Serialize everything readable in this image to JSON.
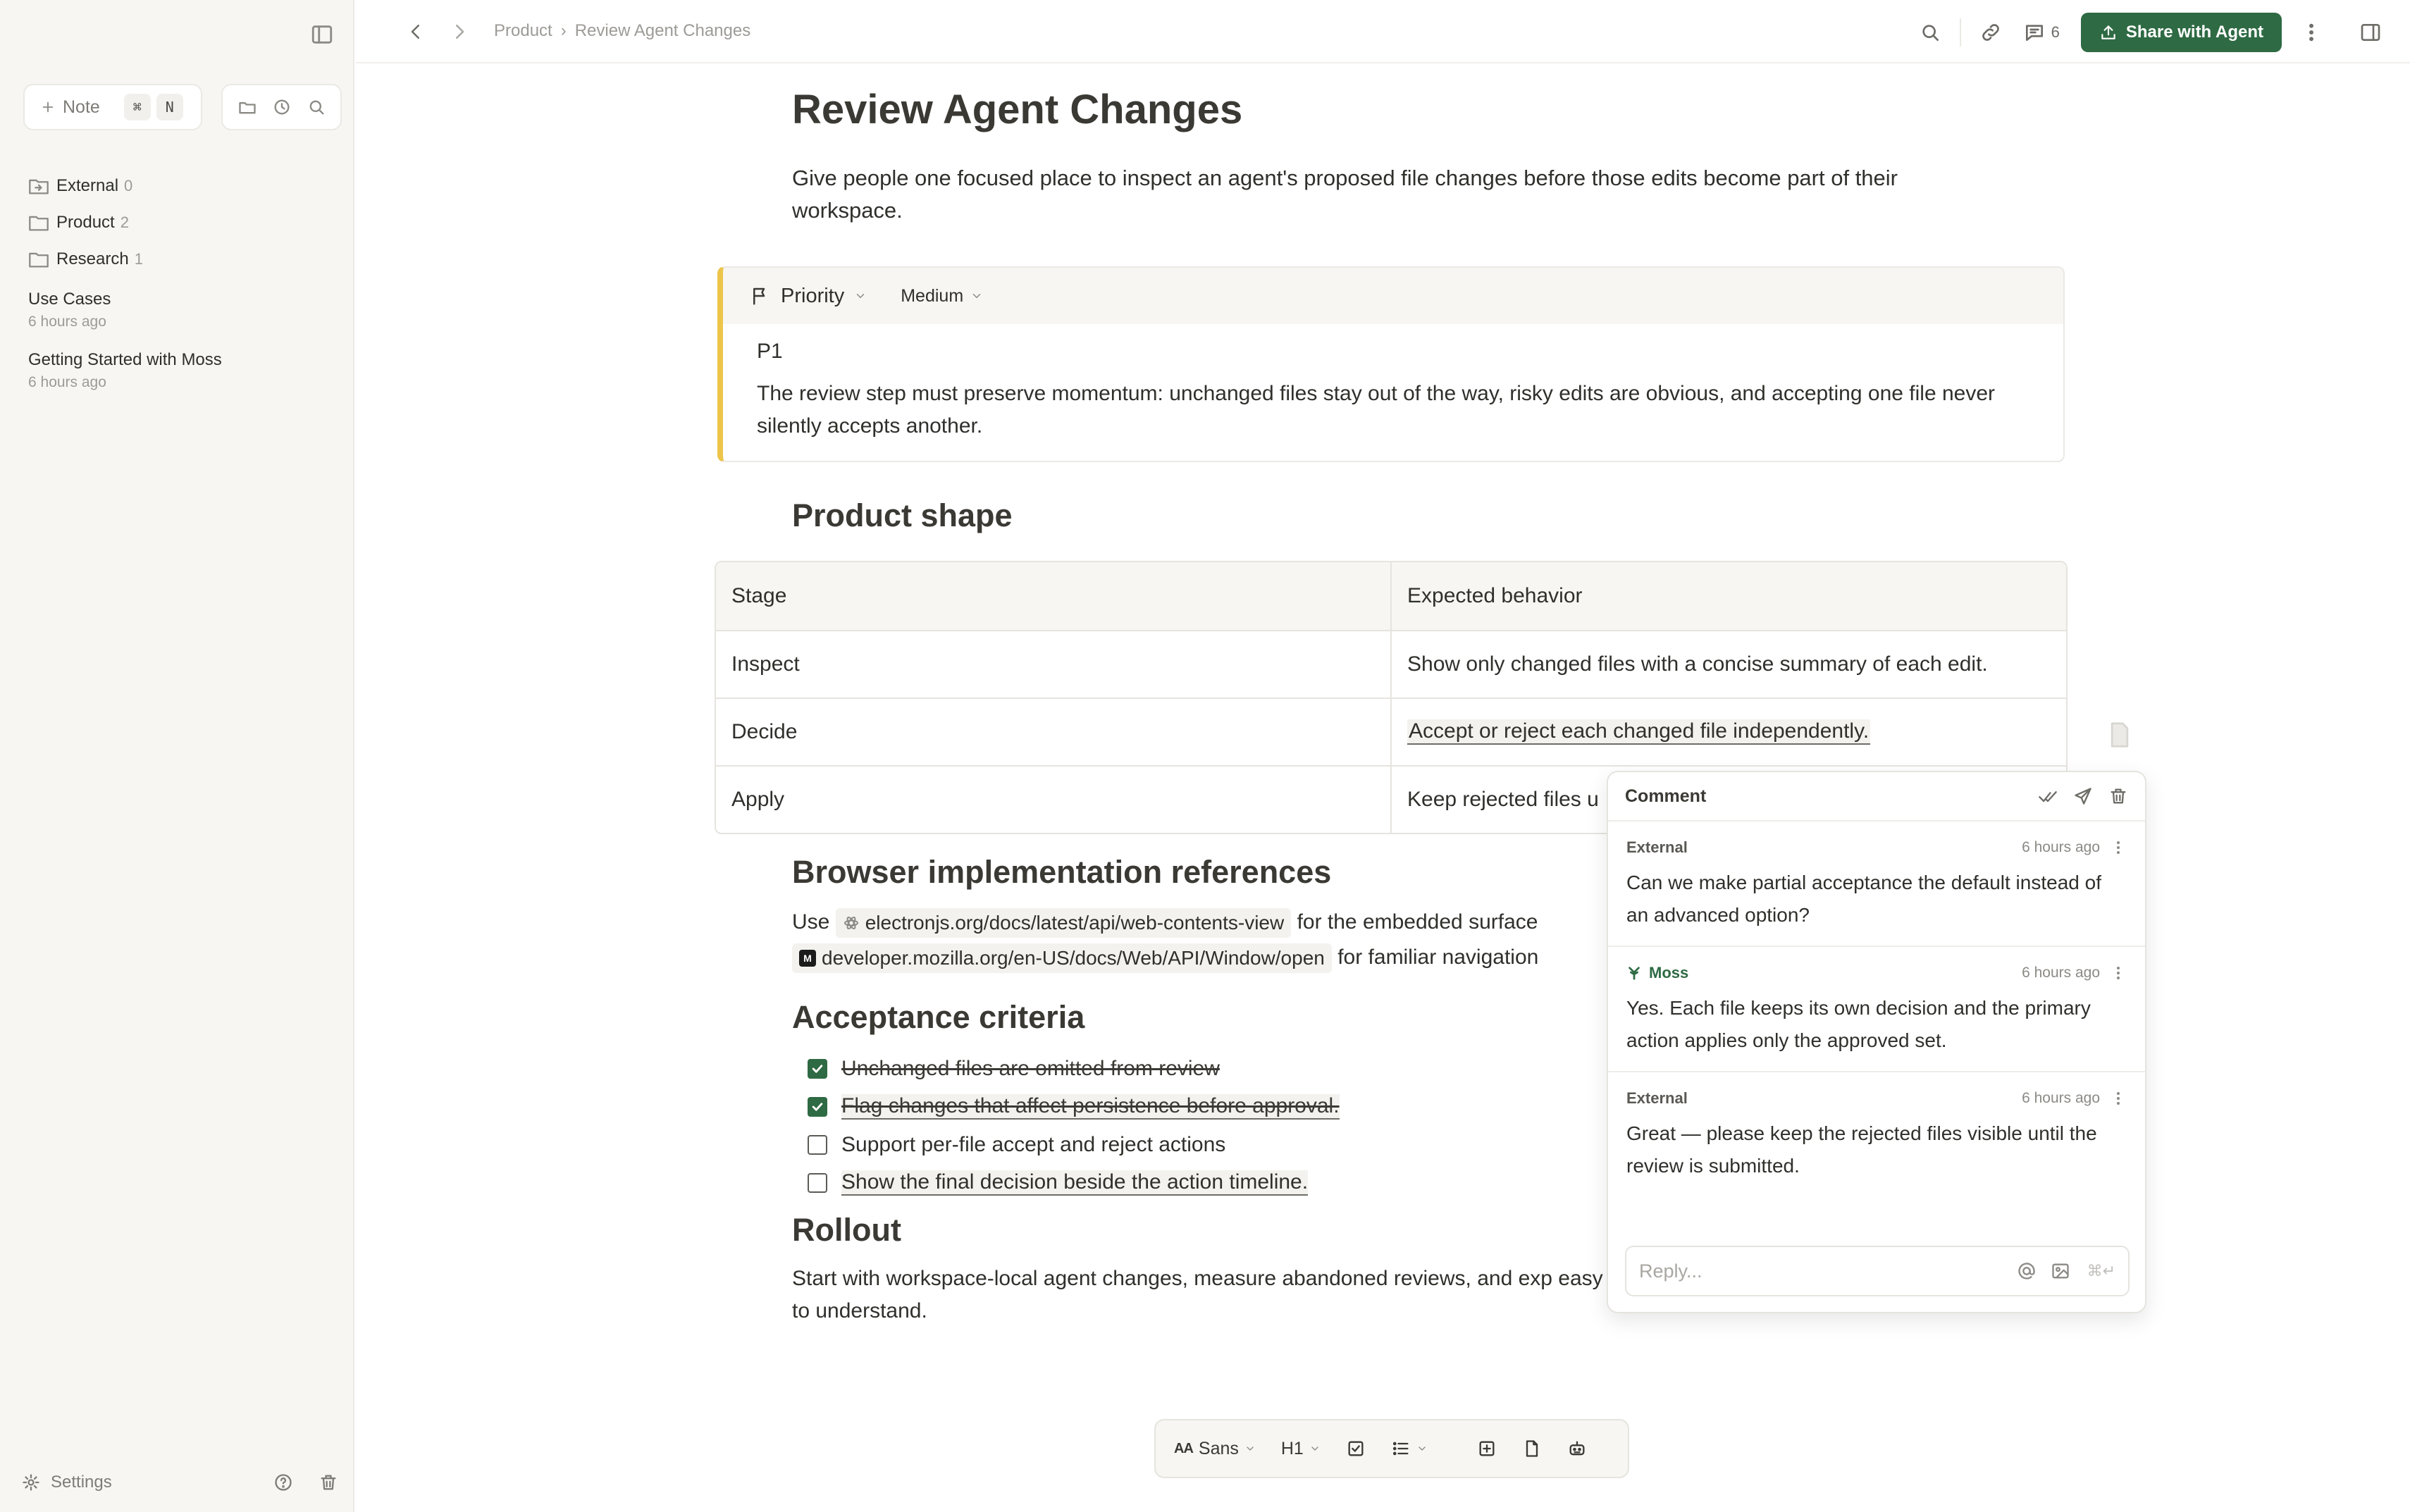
{
  "sidebar": {
    "new_note_label": "Note",
    "shortcut_keys": [
      "⌘",
      "N"
    ],
    "folders": [
      {
        "name": "External",
        "count": "0"
      },
      {
        "name": "Product",
        "count": "2"
      },
      {
        "name": "Research",
        "count": "1"
      }
    ],
    "docs": [
      {
        "title": "Use Cases",
        "time": "6 hours ago"
      },
      {
        "title": "Getting Started with Moss",
        "time": "6 hours ago"
      }
    ],
    "settings_label": "Settings"
  },
  "topbar": {
    "breadcrumb": [
      "Product",
      "Review Agent Changes"
    ],
    "comment_count": "6",
    "share_label": "Share with Agent",
    "accent_color": "#2e6a43"
  },
  "document": {
    "title": "Review Agent Changes",
    "intro": "Give people one focused place to inspect an agent's proposed file changes before those edits become part of their workspace.",
    "callout": {
      "label": "Priority",
      "value": "Medium",
      "code": "P1",
      "text": "The review step must preserve momentum: unchanged files stay out of the way, risky edits are obvious, and accepting one file never silently accepts another.",
      "border_color": "#ecc54a"
    },
    "product_shape": {
      "heading": "Product shape",
      "headers": [
        "Stage",
        "Expected behavior"
      ],
      "rows": [
        [
          "Inspect",
          "Show only changed files with a concise summary of each edit."
        ],
        [
          "Decide",
          "Accept or reject each changed file independently."
        ],
        [
          "Apply",
          "Keep rejected files u"
        ]
      ]
    },
    "browser": {
      "heading": "Browser implementation references",
      "use": "Use",
      "link1": "electronjs.org/docs/latest/api/web-contents-view",
      "text1": "for the embedded surface",
      "link2": "developer.mozilla.org/en-US/docs/Web/API/Window/open",
      "text2": "for familiar navigation"
    },
    "acceptance": {
      "heading": "Acceptance criteria",
      "items": [
        {
          "label": "Unchanged files are omitted from review",
          "done": true
        },
        {
          "label": "Flag changes that affect persistence before approval.",
          "done": true
        },
        {
          "label": "Support per-file accept and reject actions",
          "done": false
        },
        {
          "label": "Show the final decision beside the action timeline.",
          "done": false
        }
      ]
    },
    "rollout": {
      "heading": "Rollout",
      "text": "Start with workspace-local agent changes, measure abandoned reviews, and exp easy to understand."
    }
  },
  "comment_panel": {
    "title": "Comment",
    "comments": [
      {
        "author": "External",
        "time": "6 hours ago",
        "text": "Can we make partial acceptance the default instead of an advanced option?"
      },
      {
        "author": "Moss",
        "time": "6 hours ago",
        "text": "Yes. Each file keeps its own decision and the primary action applies only the approved set."
      },
      {
        "author": "External",
        "time": "6 hours ago",
        "text": "Great — please keep the rejected files visible until the review is submitted."
      }
    ],
    "reply_placeholder": "Reply...",
    "send_hint": "⌘↵"
  },
  "toolbar": {
    "font_prefix": "AA",
    "font": "Sans",
    "heading": "H1"
  }
}
